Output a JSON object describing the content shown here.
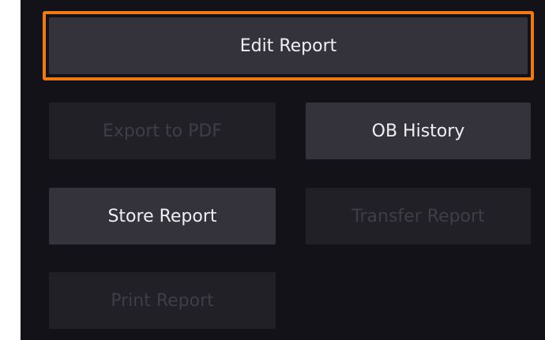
{
  "report_menu": {
    "edit_report_label": "Edit Report",
    "export_pdf_label": "Export to PDF",
    "ob_history_label": "OB History",
    "store_report_label": "Store Report",
    "transfer_report_label": "Transfer Report",
    "print_report_label": "Print Report"
  },
  "colors": {
    "panel_background": "#141219",
    "selected_outline": "#f07a12",
    "button_enabled": "#34323b",
    "button_disabled": "#222027",
    "text_enabled": "#f0eff2",
    "text_disabled": "#3f3d45"
  }
}
